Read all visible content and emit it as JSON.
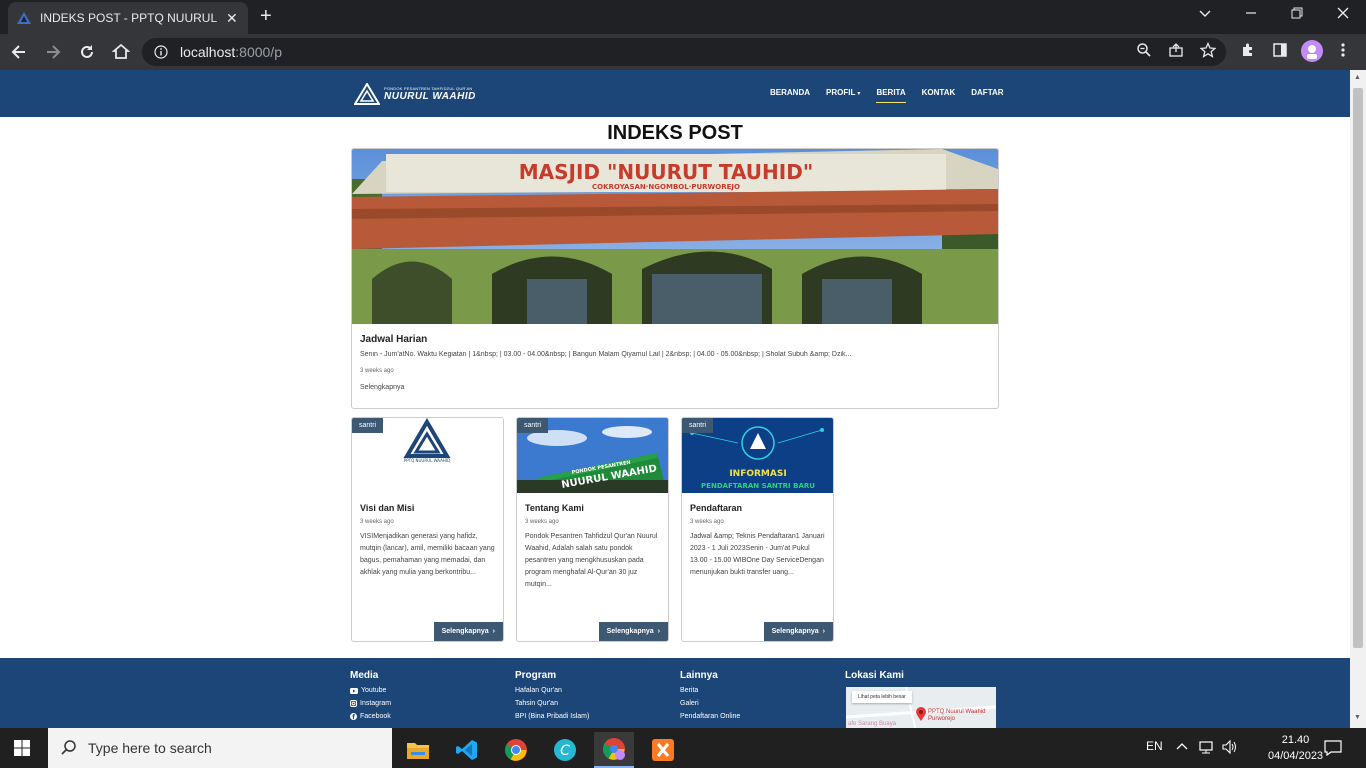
{
  "browser": {
    "tab_title": "INDEKS POST - PPTQ NUURUL WA",
    "url_host": "localhost",
    "url_path": ":8000/p"
  },
  "site": {
    "logo_small": "PONDOK PESANTREN TAHFIDZUL QUR'AN",
    "logo_big": "NUURUL WAAHID",
    "menu": [
      {
        "label": "BERANDA"
      },
      {
        "label": "PROFIL"
      },
      {
        "label": "BERITA"
      },
      {
        "label": "KONTAK"
      },
      {
        "label": "DAFTAR"
      }
    ],
    "active_menu": "BERITA",
    "colors": {
      "navbar": "#1c4677",
      "button": "#3d5873",
      "active_underline": "#f5e663"
    }
  },
  "page_title": "INDEKS POST",
  "hero": {
    "image_text": "MASJID \"NUURUT TAUHID\"",
    "image_subtext": "COKROYASAN·NGOMBOL·PURWOREJO",
    "title": "Jadwal Harian",
    "excerpt": "Senin - Jum'atNo. Waktu Kegiatan | 1&nbsp; | 03.00 - 04.00&nbsp; | Bangun Malam Qiyamul Lail | 2&nbsp; | 04.00 - 05.00&nbsp; | Sholat Subuh &amp; Dzik...",
    "time": "3 weeks ago",
    "more": "Selengkapnya"
  },
  "cards": [
    {
      "badge": "santri",
      "title": "Visi dan Misi",
      "time": "3 weeks ago",
      "excerpt": "VISIMenjadikan generasi yang hafidz, mutqin (lancar), amil, memiliki bacaan yang bagus, pemahaman yang memadai, dan akhlak yang mulia yang berkontribu...",
      "button": "Selengkapnya",
      "image_text": "PPTQ NUURUL WAAHID"
    },
    {
      "badge": "santri",
      "title": "Tentang Kami",
      "time": "3 weeks ago",
      "excerpt": "Pondok Pesantren Tahfidzul Qur'an Nuurul Waahid, Adalah salah satu pondok pesantren yang mengkhususkan pada program menghafal Al-Qur'an 30 juz mutqin...",
      "button": "Selengkapnya",
      "image_text": "PONDOK PESANTREN",
      "image_text2": "NUURUL WAAHID"
    },
    {
      "badge": "santri",
      "title": "Pendaftaran",
      "time": "3 weeks ago",
      "excerpt": "Jadwal &amp; Teknis Pendaftaran1 Januari 2023 - 1 Juli 2023Senin - Jum'at Pukul 13.00 - 15.00 WIBOne Day ServiceDengan menunjukan bukti transfer uang...",
      "button": "Selengkapnya",
      "image_text": "INFORMASI",
      "image_text2": "PENDAFTARAN SANTRI BARU"
    }
  ],
  "footer": {
    "media": {
      "heading": "Media",
      "links": [
        "Youtube",
        "Instagram",
        "Facebook"
      ]
    },
    "program": {
      "heading": "Program",
      "links": [
        "Hafalan Qur'an",
        "Tahsin Qur'an",
        "BPI (Bina Pribadi Islam)"
      ]
    },
    "lainnya": {
      "heading": "Lainnya",
      "links": [
        "Berita",
        "Galeri",
        "Pendaftaran Online"
      ]
    },
    "lokasi": {
      "heading": "Lokasi Kami",
      "map_button": "Lihat peta lebih besar",
      "map_pin": "PPTQ Nuurul Waahid Purworejo",
      "map_place": "afe Sarang Buaya"
    }
  },
  "taskbar": {
    "search_placeholder": "Type here to search",
    "lang": "EN",
    "time": "21.40",
    "date": "04/04/2023"
  }
}
